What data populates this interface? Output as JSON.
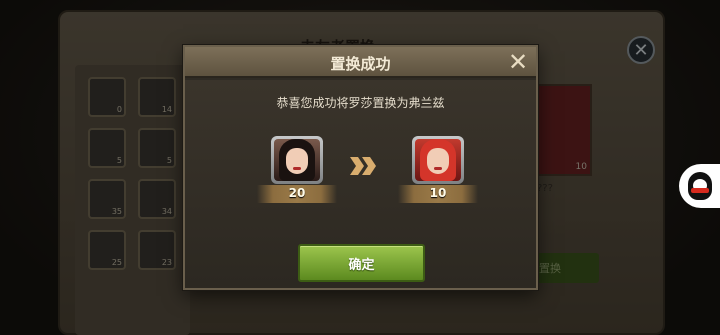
{
  "background": {
    "title": "未友者置换",
    "left_cards": [
      {
        "count": "0"
      },
      {
        "count": "14"
      },
      {
        "count": "5"
      },
      {
        "count": "5"
      },
      {
        "count": "35"
      },
      {
        "count": "34"
      },
      {
        "count": "25"
      },
      {
        "count": "23"
      }
    ],
    "right_card_count": "10",
    "right_card_caption": "???",
    "replace_button_label": "置换",
    "close_icon": "close-icon"
  },
  "dialog": {
    "title": "置换成功",
    "message": "恭喜您成功将罗莎置换为弗兰兹",
    "from_hero": {
      "count": "20"
    },
    "to_hero": {
      "count": "10"
    },
    "confirm_label": "确定"
  },
  "colors": {
    "confirm_green": "#7fae36",
    "header_brown": "#6f634c",
    "arrow_tan": "#d9ad6e"
  }
}
